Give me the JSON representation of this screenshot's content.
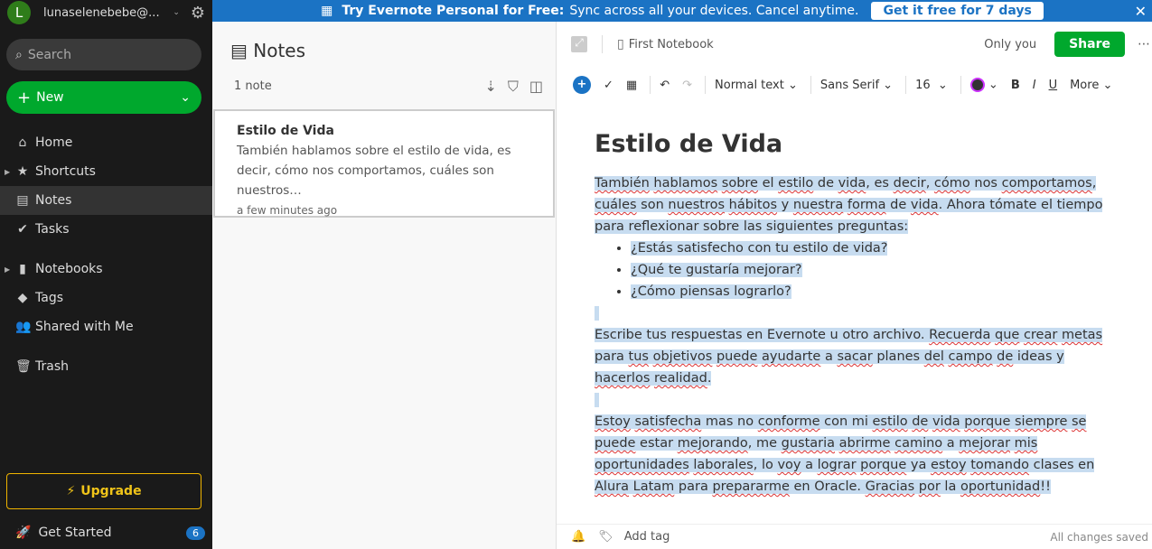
{
  "sidebar": {
    "avatar_letter": "L",
    "account": "lunaselenebebe@...",
    "search_placeholder": "Search",
    "new_label": "New",
    "items": [
      {
        "label": "Home",
        "icon": "home-icon"
      },
      {
        "label": "Shortcuts",
        "icon": "star-icon"
      },
      {
        "label": "Notes",
        "icon": "note-icon"
      },
      {
        "label": "Tasks",
        "icon": "check-circle-icon"
      },
      {
        "label": "Notebooks",
        "icon": "notebook-icon"
      },
      {
        "label": "Tags",
        "icon": "tag-icon"
      },
      {
        "label": "Shared with Me",
        "icon": "people-icon"
      },
      {
        "label": "Trash",
        "icon": "trash-icon"
      }
    ],
    "upgrade": "Upgrade",
    "get_started": "Get Started",
    "get_started_count": "6"
  },
  "banner": {
    "title": "Try Evernote Personal for Free:",
    "text": "Sync across all your devices. Cancel anytime.",
    "cta": "Get it free for 7 days"
  },
  "list": {
    "title": "Notes",
    "count": "1 note",
    "note": {
      "title": "Estilo de Vida",
      "preview": "También hablamos sobre el estilo de vida, es decir, cómo nos comportamos, cuáles son nuestros…",
      "date": "a few minutes ago"
    }
  },
  "editor": {
    "notebook": "First Notebook",
    "visibility": "Only you",
    "share": "Share",
    "toolbar": {
      "style": "Normal text",
      "font": "Sans Serif",
      "size": "16",
      "more": "More"
    },
    "title": "Estilo de Vida",
    "paragraphs": [
      [
        [
          "También",
          1
        ],
        [
          " ",
          0
        ],
        [
          "hablamos",
          1
        ],
        [
          " ",
          0
        ],
        [
          "sobre",
          1
        ],
        [
          " el ",
          0
        ],
        [
          "estilo",
          1
        ],
        [
          " de ",
          0
        ],
        [
          "vida",
          1
        ],
        [
          ", es ",
          0
        ],
        [
          "decir",
          1
        ],
        [
          ", ",
          0
        ],
        [
          "cómo",
          1
        ],
        [
          " nos ",
          0
        ],
        [
          "comportamos",
          1
        ],
        [
          ", ",
          0
        ],
        [
          "cuáles",
          1
        ],
        [
          " son ",
          0
        ],
        [
          "nuestros",
          1
        ],
        [
          " ",
          0
        ],
        [
          "hábitos",
          1
        ],
        [
          " y ",
          0
        ],
        [
          "nuestra",
          1
        ],
        [
          " ",
          0
        ],
        [
          "forma",
          1
        ],
        [
          " de ",
          0
        ],
        [
          "vida",
          1
        ],
        [
          ". Ahora tómate el tiempo para reflexionar sobre las siguientes preguntas:",
          0
        ]
      ]
    ],
    "bullets": [
      "¿Estás satisfecho con tu estilo de vida?",
      "¿Qué te gustaría mejorar?",
      "¿Cómo piensas lograrlo?"
    ],
    "paragraphs2": [
      [
        [
          "Escribe tus respuestas en Evernote u otro archivo. ",
          0
        ],
        [
          "Recuerda",
          1
        ],
        [
          " ",
          0
        ],
        [
          "que",
          1
        ],
        [
          " ",
          0
        ],
        [
          "crear",
          1
        ],
        [
          " ",
          0
        ],
        [
          "metas",
          1
        ],
        [
          " para ",
          0
        ],
        [
          "tus",
          1
        ],
        [
          " ",
          0
        ],
        [
          "objetivos",
          1
        ],
        [
          " ",
          0
        ],
        [
          "puede",
          1
        ],
        [
          " ",
          0
        ],
        [
          "ayudarte",
          1
        ],
        [
          " a ",
          0
        ],
        [
          "sacar",
          1
        ],
        [
          " planes ",
          0
        ],
        [
          "del",
          1
        ],
        [
          " ",
          0
        ],
        [
          "campo",
          1
        ],
        [
          " ",
          0
        ],
        [
          "de",
          1
        ],
        [
          " ideas y ",
          0
        ],
        [
          "hacerlos",
          1
        ],
        [
          " ",
          0
        ],
        [
          "realidad",
          1
        ],
        [
          ".",
          0
        ]
      ],
      [
        [
          "Estoy",
          1
        ],
        [
          " ",
          0
        ],
        [
          "satisfecha",
          1
        ],
        [
          " mas no ",
          0
        ],
        [
          "conforme",
          1
        ],
        [
          " con mi ",
          0
        ],
        [
          "estilo",
          1
        ],
        [
          " ",
          0
        ],
        [
          "de",
          1
        ],
        [
          " ",
          0
        ],
        [
          "vida",
          1
        ],
        [
          " ",
          0
        ],
        [
          "porque",
          1
        ],
        [
          " ",
          0
        ],
        [
          "siempre",
          1
        ],
        [
          " ",
          0
        ],
        [
          "se",
          1
        ],
        [
          " ",
          0
        ],
        [
          "puede",
          1
        ],
        [
          " estar ",
          0
        ],
        [
          "mejorando",
          1
        ],
        [
          ", me ",
          0
        ],
        [
          "gustaria",
          1
        ],
        [
          " ",
          0
        ],
        [
          "abrirme",
          1
        ],
        [
          " ",
          0
        ],
        [
          "camino",
          1
        ],
        [
          " a ",
          0
        ],
        [
          "mejorar",
          1
        ],
        [
          " ",
          0
        ],
        [
          "mis",
          1
        ],
        [
          " ",
          0
        ],
        [
          "oportunidades",
          1
        ],
        [
          " ",
          0
        ],
        [
          "laborales",
          1
        ],
        [
          ", lo ",
          0
        ],
        [
          "voy",
          1
        ],
        [
          " a ",
          0
        ],
        [
          "lograr",
          1
        ],
        [
          " ",
          0
        ],
        [
          "porque",
          1
        ],
        [
          " ya ",
          0
        ],
        [
          "estoy",
          1
        ],
        [
          " ",
          0
        ],
        [
          "tomando",
          1
        ],
        [
          " clases en ",
          0
        ],
        [
          "Alura",
          1
        ],
        [
          " ",
          0
        ],
        [
          "Latam",
          1
        ],
        [
          " para ",
          0
        ],
        [
          "prepararme",
          1
        ],
        [
          " en Oracle. ",
          0
        ],
        [
          "Gracias",
          1
        ],
        [
          " ",
          0
        ],
        [
          "por",
          1
        ],
        [
          " la ",
          0
        ],
        [
          "oportunidad",
          1
        ],
        [
          "!!",
          0
        ]
      ]
    ],
    "add_tag": "Add tag",
    "status": "All changes saved"
  }
}
